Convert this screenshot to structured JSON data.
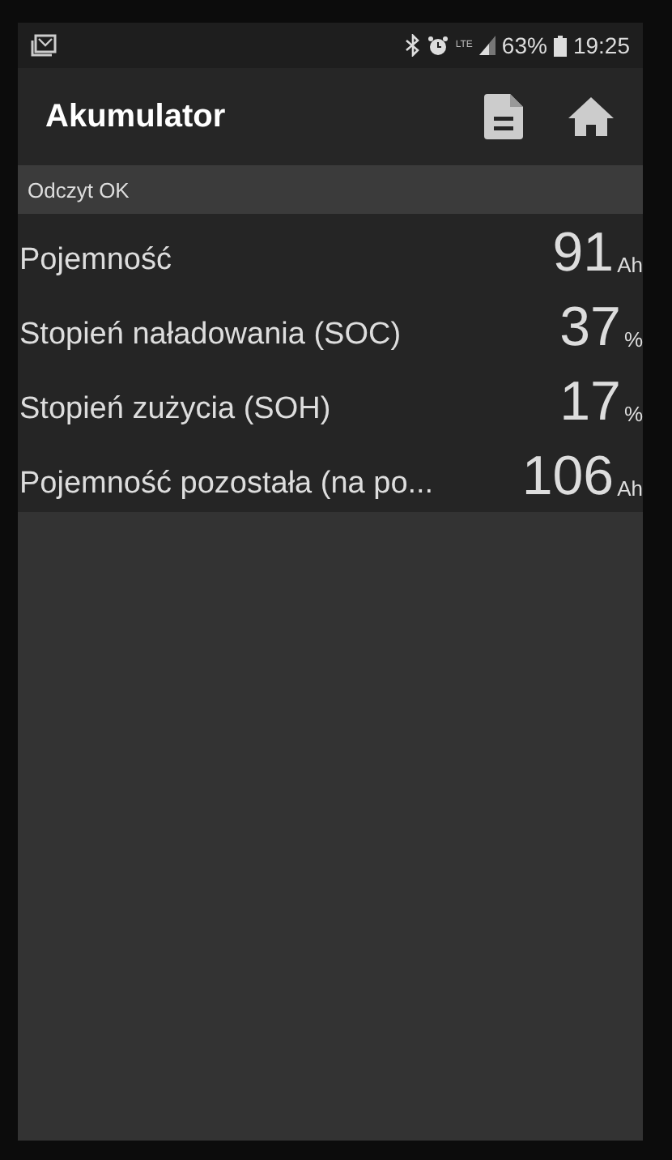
{
  "status_bar": {
    "network": "LTE",
    "battery": "63%",
    "time": "19:25"
  },
  "app_bar": {
    "title": "Akumulator"
  },
  "status_message": "Odczyt OK",
  "readings": [
    {
      "label": "Pojemność",
      "value": "91",
      "unit": "Ah"
    },
    {
      "label": "Stopień naładowania (SOC)",
      "value": "37",
      "unit": "%"
    },
    {
      "label": "Stopień zużycia (SOH)",
      "value": "17",
      "unit": "%"
    },
    {
      "label": "Pojemność pozostała (na po...",
      "value": "106",
      "unit": "Ah"
    }
  ]
}
